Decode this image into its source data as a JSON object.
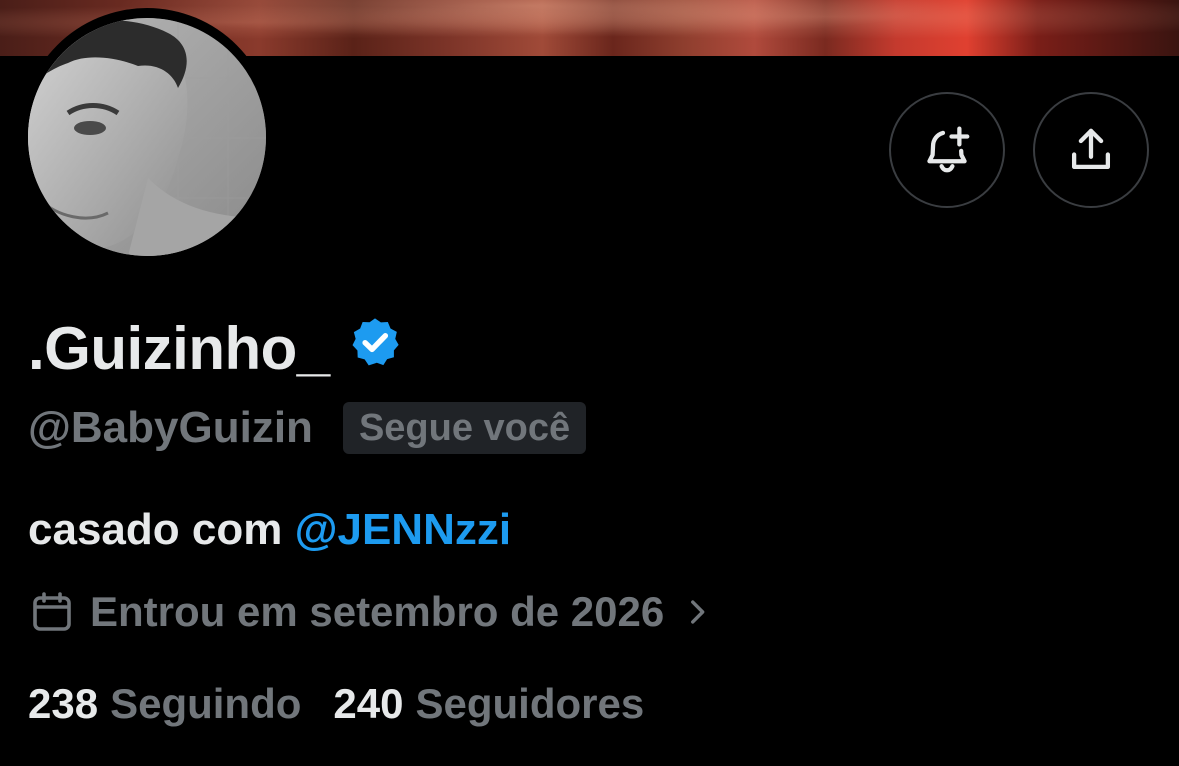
{
  "profile": {
    "display_name": ".Guizinho_",
    "handle": "@BabyGuizin",
    "follows_you_badge": "Segue você",
    "bio_prefix": "casado com",
    "bio_mention": "@JENNzzi",
    "joined": "Entrou em setembro de 2026",
    "following_count": "238",
    "following_label": "Seguindo",
    "followers_count": "240",
    "followers_label": "Seguidores"
  },
  "icons": {
    "notify": "bell-plus-icon",
    "share": "share-icon",
    "verified": "verified-badge-icon",
    "calendar": "calendar-icon",
    "chevron": "chevron-right-icon"
  },
  "colors": {
    "background": "#000000",
    "text_primary": "#e7e9ea",
    "text_secondary": "#71767b",
    "accent": "#1d9bf0",
    "badge_bg": "#202327",
    "button_border": "#3a3d41"
  }
}
